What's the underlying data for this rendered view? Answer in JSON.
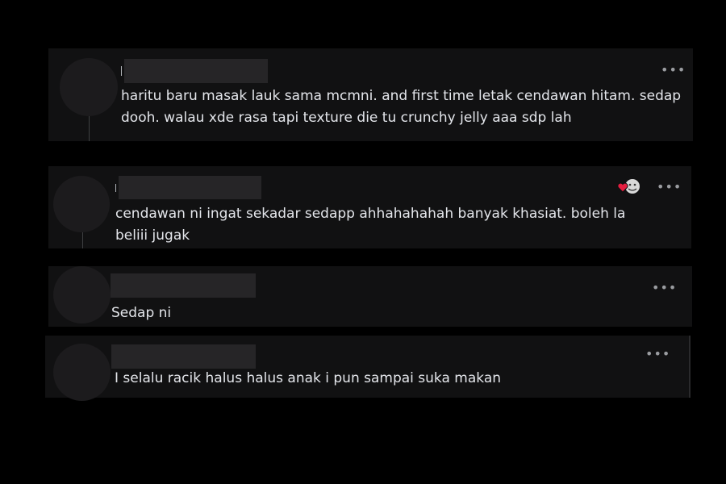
{
  "comments": [
    {
      "id": "comment-1",
      "author": "",
      "text": "haritu baru masak lauk sama mcmni. and first time letak cendawan hitam. sedap dooh. walau xde rasa tapi texture die tu crunchy jelly aaa sdp lah",
      "more_label": "•••"
    },
    {
      "id": "comment-2",
      "author": "",
      "text": "cendawan ni ingat sekadar sedapp ahhahahahah banyak khasiat. boleh la beliii jugak",
      "more_label": "•••",
      "reactions": [
        "heart-icon",
        "care-icon"
      ]
    },
    {
      "id": "comment-3",
      "author": "",
      "text": "Sedap ni",
      "more_label": "•••"
    },
    {
      "id": "comment-4",
      "author": "",
      "text": "I selalu racik halus halus anak i pun sampai suka makan",
      "more_label": "•••"
    }
  ],
  "colors": {
    "background": "#000000",
    "card": "#111112",
    "text": "#e4e6eb",
    "redaction": "#262527",
    "heart": "#e41e3f"
  }
}
